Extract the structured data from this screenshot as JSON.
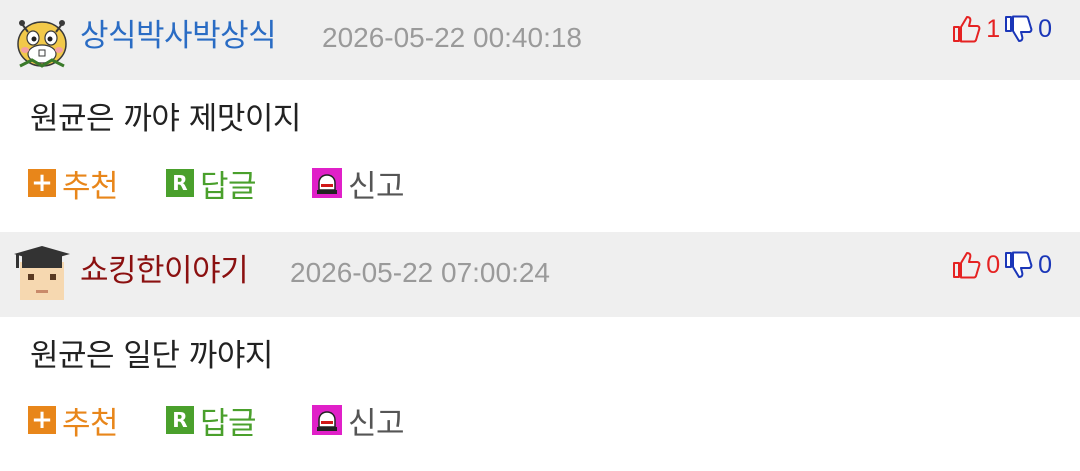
{
  "comments": [
    {
      "author": "상식박사박상식",
      "author_color": "#2a6cc4",
      "timestamp": "2026-05-22 00:40:18",
      "likes": "1",
      "dislikes": "0",
      "body": "원균은 까야 제맛이지",
      "avatar_icon": "hamster-avatar-icon",
      "actions": {
        "recommend": "추천",
        "reply": "답글",
        "report": "신고"
      }
    },
    {
      "author": "쇼킹한이야기",
      "author_color": "#8b1010",
      "timestamp": "2026-05-22 07:00:24",
      "likes": "0",
      "dislikes": "0",
      "body": "원균은 일단 까야지",
      "avatar_icon": "graduate-avatar-icon",
      "actions": {
        "recommend": "추천",
        "reply": "답글",
        "report": "신고"
      }
    }
  ],
  "colors": {
    "header_bg": "#efefef",
    "timestamp": "#9a9a9a",
    "like": "#e52222",
    "dislike": "#1a36b8",
    "recommend": "#e8861a",
    "reply": "#4aa02c",
    "report_icon": "#e020c8",
    "report_label": "#555555"
  }
}
